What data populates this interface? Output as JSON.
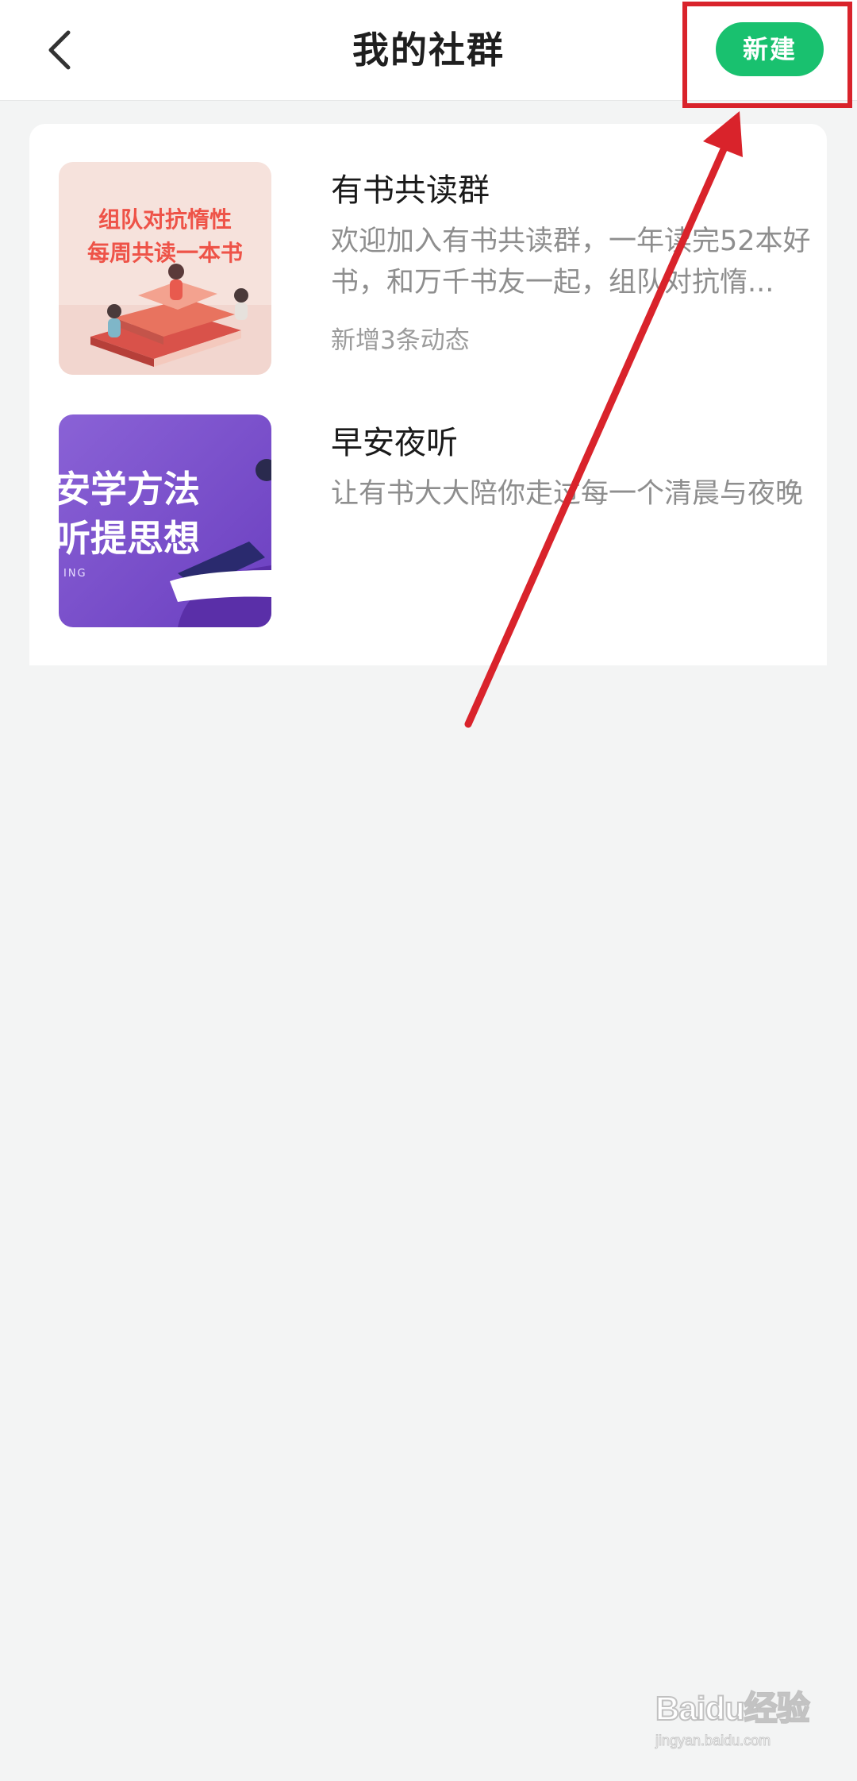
{
  "header": {
    "back_icon": "chevron-left-icon",
    "title": "我的社群",
    "new_button_label": "新建"
  },
  "groups": [
    {
      "title": "有书共读群",
      "description": "欢迎加入有书共读群，一年读完52本好书，和万千书友一起，组队对抗惰...",
      "meta": "新增3条动态",
      "cover_lines": [
        "组队对抗惰性",
        "每周共读一本书"
      ]
    },
    {
      "title": "早安夜听",
      "description": "让有书大大陪你走过每一个清晨与夜晚",
      "meta": "",
      "cover_lines": [
        "安学方法",
        "听提思想",
        "ING"
      ]
    }
  ],
  "watermark": {
    "brand": "Baidu经验",
    "url": "jingyan.baidu.com"
  },
  "colors": {
    "accent_green": "#19c16f",
    "annotation_red": "#d9232b",
    "background": "#f3f4f4"
  }
}
